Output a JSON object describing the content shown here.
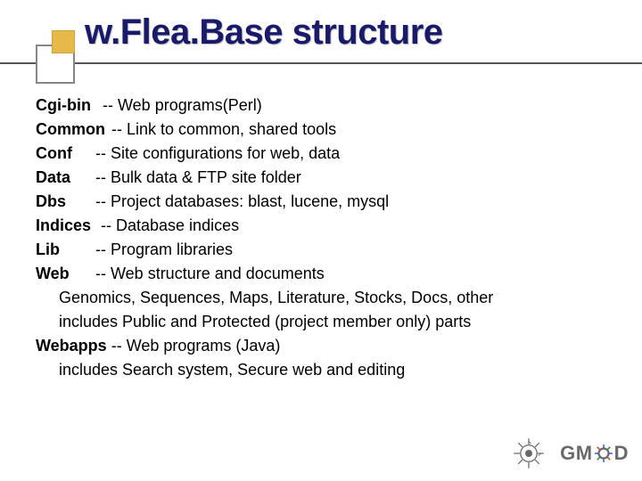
{
  "title": "w.Flea.Base structure",
  "items": [
    {
      "term": "Cgi-bin",
      "desc": "-- Web programs(Perl)"
    },
    {
      "term": "Common",
      "desc": "-- Link to common, shared tools"
    },
    {
      "term": "Conf",
      "desc": "-- Site configurations for web, data"
    },
    {
      "term": "Data",
      "desc": "-- Bulk data & FTP site folder"
    },
    {
      "term": "Dbs",
      "desc": "-- Project databases: blast, lucene, mysql"
    },
    {
      "term": "Indices",
      "desc": "-- Database indices"
    },
    {
      "term": "Lib",
      "desc": "-- Program libraries"
    },
    {
      "term": "Web",
      "desc": "-- Web structure and documents",
      "sub": [
        "Genomics, Sequences, Maps, Literature, Stocks, Docs, other",
        "includes Public and Protected (project member only) parts"
      ]
    },
    {
      "term": "Webapps",
      "desc": " -- Web programs (Java)",
      "sub": [
        "includes Search system, Secure web and editing"
      ]
    }
  ],
  "footer": {
    "gmod_pre": "GM",
    "gmod_post": "D"
  }
}
